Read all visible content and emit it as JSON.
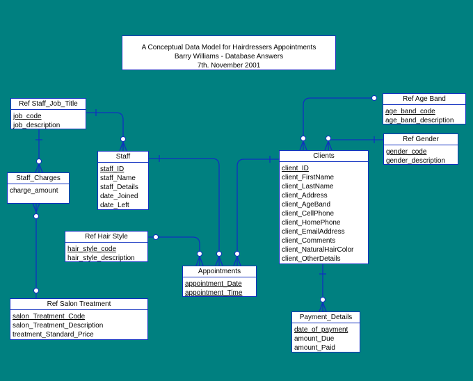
{
  "title": {
    "line1": "A Conceptual Data Model for Hairdressers Appointments",
    "line2": "Barry Williams - Database Answers",
    "line3": "7th. November 2001"
  },
  "colors": {
    "background": "#008080",
    "line": "#1030c0",
    "box": "#ffffff"
  },
  "entities": {
    "ref_staff_job_title": {
      "name": "Ref Staff_Job_Title",
      "attrs": [
        "job_code",
        "job_description"
      ],
      "pk": [
        "job_code"
      ]
    },
    "staff_charges": {
      "name": "Staff_Charges",
      "attrs": [
        "charge_amount"
      ],
      "pk": []
    },
    "staff": {
      "name": "Staff",
      "attrs": [
        "staff_ID",
        "staff_Name",
        "staff_Details",
        "date_Joined",
        "date_Left"
      ],
      "pk": [
        "staff_ID"
      ]
    },
    "ref_age_band": {
      "name": "Ref Age Band",
      "attrs": [
        "age_band_code",
        "age_band_description"
      ],
      "pk": [
        "age_band_code"
      ]
    },
    "ref_gender": {
      "name": "Ref Gender",
      "attrs": [
        "gender_code",
        "gender_description"
      ],
      "pk": [
        "gender_code"
      ]
    },
    "clients": {
      "name": "Clients",
      "attrs": [
        "client_ID",
        "client_FirstName",
        "client_LastName",
        "client_Address",
        "client_AgeBand",
        "client_CellPhone",
        "client_HomePhone",
        "client_EmailAddress",
        "client_Comments",
        "client_NaturalHairColor",
        "client_OtherDetails"
      ],
      "pk": [
        "client_ID"
      ]
    },
    "ref_hair_style": {
      "name": "Ref Hair Style",
      "attrs": [
        "hair_style_code",
        "hair_style_description"
      ],
      "pk": [
        "hair_style_code"
      ]
    },
    "appointments": {
      "name": "Appointments",
      "attrs": [
        "appointment_Date",
        "appointment_Time"
      ],
      "pk": [
        "appointment_Date",
        "appointment_Time"
      ]
    },
    "ref_salon_treatment": {
      "name": "Ref Salon Treatment",
      "attrs": [
        "salon_Treatment_Code",
        "salon_Treatment_Description",
        "treatment_Standard_Price"
      ],
      "pk": [
        "salon_Treatment_Code"
      ]
    },
    "payment_details": {
      "name": "Payment_Details",
      "attrs": [
        "date_of_payment",
        "amount_Due",
        "amount_Paid"
      ],
      "pk": [
        "date_of_payment"
      ]
    }
  },
  "relationships": [
    {
      "from": "Ref Staff_Job_Title",
      "to": "Staff",
      "type": "one-to-many-optional"
    },
    {
      "from": "Ref Staff_Job_Title",
      "to": "Staff_Charges",
      "type": "one-to-many-optional"
    },
    {
      "from": "Ref Salon Treatment",
      "to": "Staff_Charges",
      "type": "many-optional"
    },
    {
      "from": "Staff",
      "to": "Appointments",
      "type": "one-to-many-optional"
    },
    {
      "from": "Clients",
      "to": "Appointments",
      "type": "one-to-many-optional"
    },
    {
      "from": "Ref Hair Style",
      "to": "Appointments",
      "type": "zero-to-many"
    },
    {
      "from": "Ref Age Band",
      "to": "Clients",
      "type": "zero-to-many"
    },
    {
      "from": "Ref Gender",
      "to": "Clients",
      "type": "one-to-many-optional"
    },
    {
      "from": "Clients",
      "to": "Payment_Details",
      "type": "one-to-many-optional"
    }
  ]
}
